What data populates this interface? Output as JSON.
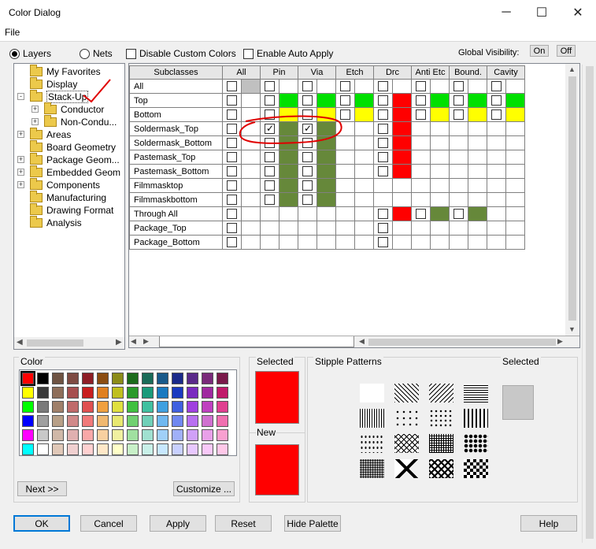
{
  "window": {
    "title": "Color Dialog"
  },
  "menu": {
    "file": "File"
  },
  "options": {
    "layers": "Layers",
    "nets": "Nets",
    "disable_custom": "Disable Custom Colors",
    "enable_auto": "Enable Auto Apply",
    "global_visibility": "Global Visibility:",
    "on": "On",
    "off": "Off"
  },
  "tree": [
    {
      "label": "My Favorites"
    },
    {
      "label": "Display"
    },
    {
      "label": "Stack-Up"
    },
    {
      "label": "Conductor"
    },
    {
      "label": "Non-Condu..."
    },
    {
      "label": "Areas"
    },
    {
      "label": "Board Geometry"
    },
    {
      "label": "Package Geom..."
    },
    {
      "label": "Embedded Geom"
    },
    {
      "label": "Components"
    },
    {
      "label": "Manufacturing"
    },
    {
      "label": "Drawing Format"
    },
    {
      "label": "Analysis"
    }
  ],
  "grid": {
    "headers": [
      "Subclasses",
      "All",
      "Pin",
      "Via",
      "Etch",
      "Drc",
      "Anti Etc",
      "Bound.",
      "Cavity"
    ],
    "rows": [
      "All",
      "Top",
      "Bottom",
      "Soldermask_Top",
      "Soldermask_Bottom",
      "Pastemask_Top",
      "Pastemask_Bottom",
      "Filmmasktop",
      "Filmmaskbottom",
      "Through All",
      "Package_Top",
      "Package_Bottom"
    ]
  },
  "colors": {
    "green": "#00e000",
    "yellow": "#ffff00",
    "red": "#ff0000",
    "olive": "#66883a",
    "grey": "#c0c0c0",
    "accent": "#0078d7",
    "annotation": "#e00000"
  },
  "palette": {
    "title": "Color",
    "next": "Next >>",
    "customize": "Customize ..."
  },
  "selected": {
    "title": "Selected",
    "new": "New",
    "color": "#ff0000"
  },
  "stipple": {
    "title": "Stipple Patterns",
    "selected": "Selected"
  },
  "buttons": {
    "ok": "OK",
    "cancel": "Cancel",
    "apply": "Apply",
    "reset": "Reset",
    "hide_palette": "Hide Palette",
    "help": "Help"
  }
}
